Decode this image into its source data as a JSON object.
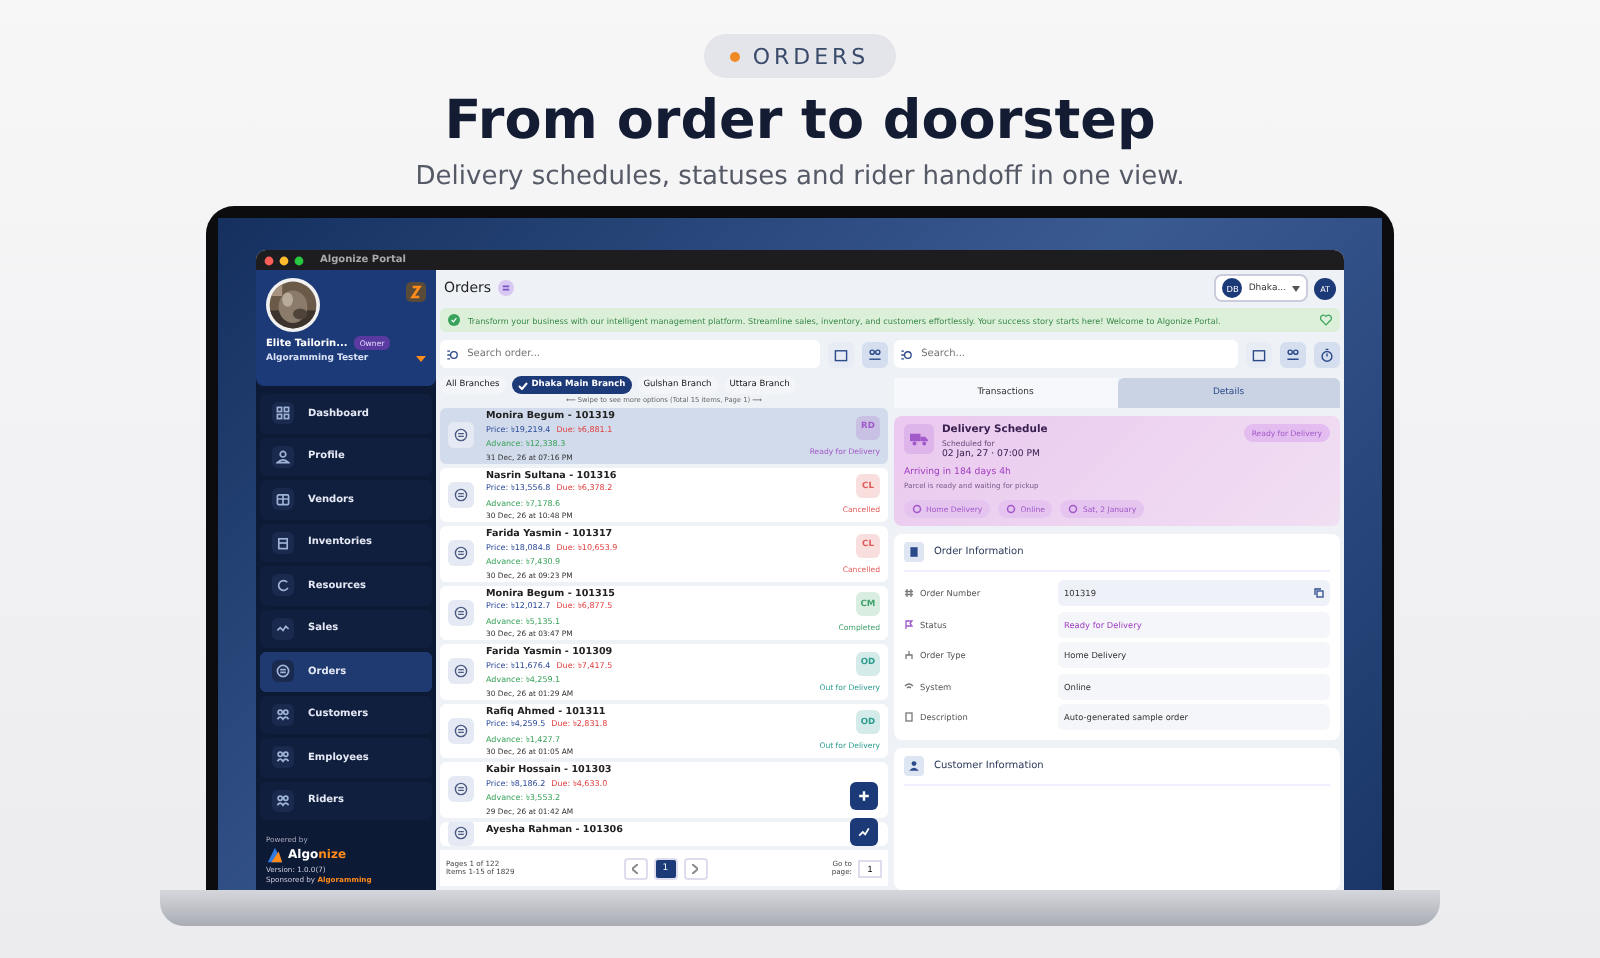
{
  "header": {
    "tag": "ORDERS",
    "title": "From order to doorstep",
    "subtitle": "Delivery schedules, statuses and rider handoff in one view."
  },
  "window": {
    "title": "Algonize Portal"
  },
  "sidebar": {
    "business": "Elite Tailorin...",
    "role": "Owner",
    "user": "Algoramming Tester",
    "items": [
      {
        "label": "Dashboard",
        "selected": false
      },
      {
        "label": "Profile",
        "selected": false
      },
      {
        "label": "Vendors",
        "selected": false
      },
      {
        "label": "Inventories",
        "selected": false
      },
      {
        "label": "Resources",
        "selected": false
      },
      {
        "label": "Sales",
        "selected": false
      },
      {
        "label": "Orders",
        "selected": true
      },
      {
        "label": "Customers",
        "selected": false
      },
      {
        "label": "Employees",
        "selected": false
      },
      {
        "label": "Riders",
        "selected": false
      }
    ],
    "footer": {
      "powered": "Powered by",
      "brand_a": "Algo",
      "brand_b": "nize",
      "version": "Version: 1.0.0(7)",
      "sponsor": "Sponsored by **Algoramming**"
    }
  },
  "topbar": {
    "title": "Orders",
    "branch_initials": "DB",
    "branch": "Dhaka...",
    "user_initials": "AT"
  },
  "banner": "Transform your business with our intelligent management platform. Streamline sales, inventory, and customers effortlessly. Your success story starts here! Welcome to Algonize Portal.",
  "order_list": {
    "search": {
      "placeholder": "Search order..."
    },
    "branches": [
      {
        "label": "All Branches",
        "selected": false
      },
      {
        "label": "Dhaka Main Branch",
        "selected": true
      },
      {
        "label": "Gulshan Branch",
        "selected": false
      },
      {
        "label": "Uttara Branch",
        "selected": false
      }
    ],
    "hint": "⟵ Swipe to see more options (Total 15 items, Page 1) ⟶",
    "orders": [
      {
        "name": "Monira Begum - 101319",
        "price": "Price: ৳19,219.4",
        "due": "Due: ৳6,881.1",
        "advance": "Advance: ৳12,338.3",
        "date": "31 Dec, 26 at 07:16 PM",
        "badge": "RD",
        "status": "Ready for Delivery",
        "color": "#a259c9",
        "selected": true
      },
      {
        "name": "Nasrin Sultana - 101316",
        "price": "Price: ৳13,556.8",
        "due": "Due: ৳6,378.2",
        "advance": "Advance: ৳7,178.6",
        "date": "30 Dec, 26 at 10:48 PM",
        "badge": "CL",
        "status": "Cancelled",
        "color": "#e05a5a",
        "selected": false
      },
      {
        "name": "Farida Yasmin - 101317",
        "price": "Price: ৳18,084.8",
        "due": "Due: ৳10,653.9",
        "advance": "Advance: ৳7,430.9",
        "date": "30 Dec, 26 at 09:23 PM",
        "badge": "CL",
        "status": "Cancelled",
        "color": "#e05a5a",
        "selected": false
      },
      {
        "name": "Monira Begum - 101315",
        "price": "Price: ৳12,012.7",
        "due": "Due: ৳6,877.5",
        "advance": "Advance: ৳5,135.1",
        "date": "30 Dec, 26 at 03:47 PM",
        "badge": "CM",
        "status": "Completed",
        "color": "#3fa36b",
        "selected": false
      },
      {
        "name": "Farida Yasmin - 101309",
        "price": "Price: ৳11,676.4",
        "due": "Due: ৳7,417.5",
        "advance": "Advance: ৳4,259.1",
        "date": "30 Dec, 26 at 01:29 AM",
        "badge": "OD",
        "status": "Out for Delivery",
        "color": "#2c9c8f",
        "selected": false
      },
      {
        "name": "Rafiq Ahmed - 101311",
        "price": "Price: ৳4,259.5",
        "due": "Due: ৳2,831.8",
        "advance": "Advance: ৳1,427.7",
        "date": "30 Dec, 26 at 01:05 AM",
        "badge": "OD",
        "status": "Out for Delivery",
        "color": "#2c9c8f",
        "selected": false
      },
      {
        "name": "Kabir Hossain - 101303",
        "price": "Price: ৳8,186.2",
        "due": "Due: ৳4,633.0",
        "advance": "Advance: ৳3,553.2",
        "date": "29 Dec, 26 at 01:42 AM",
        "selected": false
      },
      {
        "name": "Ayesha Rahman - 101306",
        "selected": false
      }
    ],
    "pager": {
      "pages": "Pages 1 of 122",
      "items": "Items 1-15 of 1829",
      "current": "1",
      "goto_label": "Go to page:",
      "goto_value": "1"
    }
  },
  "details": {
    "search": {
      "placeholder": "Search..."
    },
    "tabs": [
      {
        "label": "Transactions",
        "selected": false
      },
      {
        "label": "Details",
        "selected": true
      }
    ],
    "delivery": {
      "title": "Delivery Schedule",
      "sub": "Scheduled for",
      "when": "02 Jan, 27 · 07:00 PM",
      "badge": "Ready for Delivery",
      "arriving": "Arriving in 184 days 4h",
      "note": "Parcel is ready and waiting for pickup",
      "chips": [
        "Home Delivery",
        "Online",
        "Sat, 2 January"
      ]
    },
    "order_info": {
      "title": "Order Information",
      "rows": [
        {
          "label": "Order Number",
          "value": "101319",
          "kind": "copy"
        },
        {
          "label": "Status",
          "value": "Ready for Delivery",
          "kind": "status"
        },
        {
          "label": "Order Type",
          "value": "Home Delivery",
          "kind": "plain"
        },
        {
          "label": "System",
          "value": "Online",
          "kind": "plain"
        },
        {
          "label": "Description",
          "value": "Auto-generated sample order",
          "kind": "plain"
        }
      ]
    },
    "customer_info": {
      "title": "Customer Information"
    }
  }
}
